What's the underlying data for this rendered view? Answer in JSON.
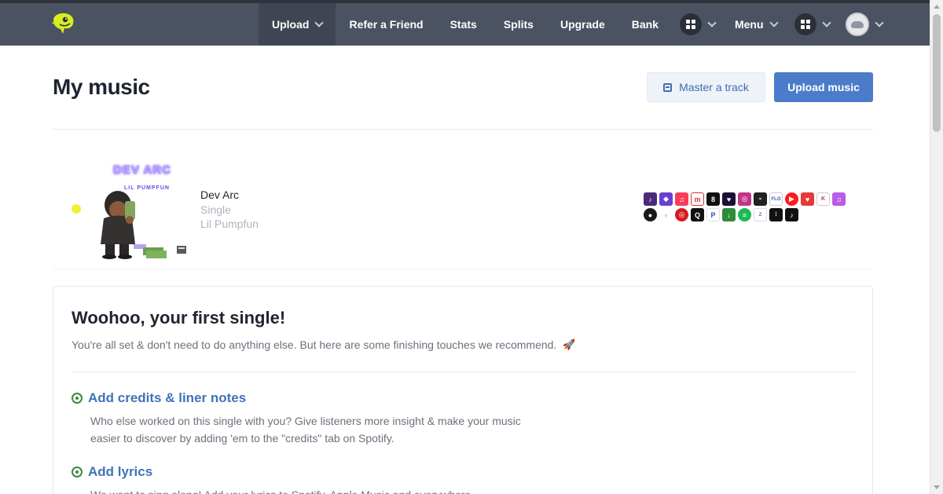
{
  "nav": {
    "items": [
      {
        "label": "Upload",
        "dropdown": true,
        "active": true
      },
      {
        "label": "Refer a Friend"
      },
      {
        "label": "Stats"
      },
      {
        "label": "Splits"
      },
      {
        "label": "Upgrade"
      },
      {
        "label": "Bank"
      }
    ],
    "menu_label": "Menu",
    "icons": [
      "apps-grid-icon",
      "apps-grid-icon",
      "user-avatar"
    ]
  },
  "header": {
    "title": "My music",
    "master_label": "Master a track",
    "upload_label": "Upload music"
  },
  "release": {
    "cover_title": "DEV ARC",
    "cover_artist": "LIL PUMPFUN",
    "title": "Dev Arc",
    "type": "Single",
    "artist": "Lil Pumpfun",
    "status_color": "#eef03a",
    "store_icon_count": 24
  },
  "card": {
    "title": "Woohoo, your first single!",
    "subtitle": "You're all set & don't need to do anything else. But here are some finishing touches we recommend.",
    "tips": [
      {
        "title": "Add credits & liner notes",
        "desc": "Who else worked on this single with you? Give listeners more insight & make your music easier to discover by adding 'em to the \"credits\" tab on Spotify."
      },
      {
        "title": "Add lyrics",
        "desc": "We want to sing along! Add your lyrics to Spotify, Apple Music and everywhere"
      }
    ]
  },
  "colors": {
    "topbar": "#4b5261",
    "primary": "#4b7cc9",
    "link": "#3f74b9",
    "check": "#3a8a3a"
  }
}
